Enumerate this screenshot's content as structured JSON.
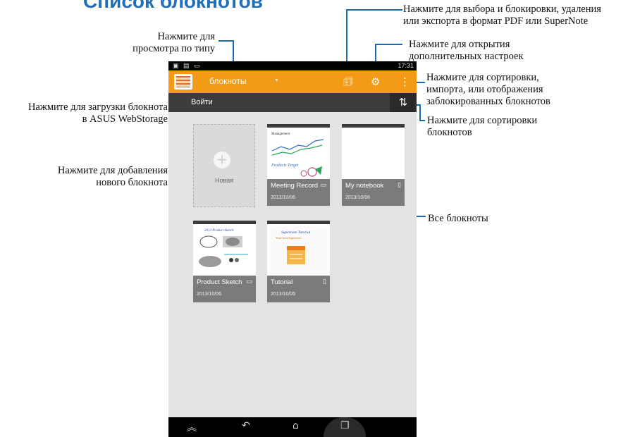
{
  "heading": "Список блокнотов",
  "callouts": {
    "select_lock": [
      "Нажмите для выбора и блокировки, удаления",
      "или экспорта в формат PDF или SuperNote"
    ],
    "settings": [
      "Нажмите для открытия",
      "дополнительных настроек"
    ],
    "sort_import": [
      "Нажмите для сортировки,",
      "импорта, или отображения",
      "заблокированных блокнотов"
    ],
    "sort": [
      "Нажмите для сортировки",
      "блокнотов"
    ],
    "view_type": [
      "Нажмите для",
      "просмотра по типу"
    ],
    "upload": [
      "Нажмите для загрузки блокнота",
      "в ASUS WebStorage"
    ],
    "add": [
      "Нажмите для добавления",
      "нового блокнота"
    ],
    "all": "Все блокноты"
  },
  "phone": {
    "status_time": "17:31",
    "app_title": "блокноты",
    "login": "Войти",
    "new_label": "Новая",
    "notebooks": [
      {
        "name": "Meeting Record",
        "date": "2013/10/06",
        "thumb_title": "Management",
        "thumb_caption": "Products Target"
      },
      {
        "name": "My notebook",
        "date": "2013/10/06"
      },
      {
        "name": "Product Sketch",
        "date": "2013/10/06",
        "thumb_title": "2013 Product Sketch"
      },
      {
        "name": "Tutorial",
        "date": "2013/10/06",
        "thumb_title": "Supernote Tutorial",
        "thumb_caption": "Your best Supernote"
      }
    ]
  },
  "colors": {
    "callout_line": "#1b6bb0",
    "actionbar": "#f39a17",
    "heading": "#1f6fb8"
  },
  "icons": [
    "select-edit-icon",
    "gear-icon",
    "overflow-menu-icon",
    "sort-icon",
    "plus-icon",
    "notebook-icon",
    "back-icon",
    "home-icon",
    "recent-apps-icon"
  ]
}
